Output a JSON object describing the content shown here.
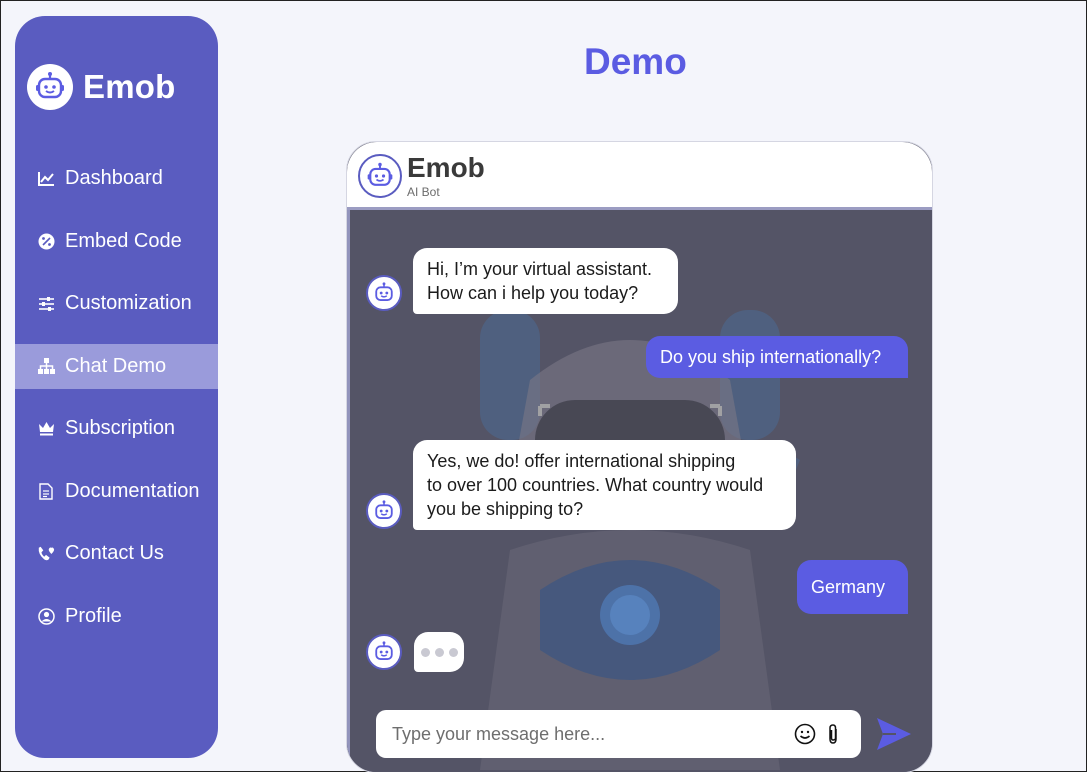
{
  "brand": {
    "name": "Emob"
  },
  "nav": {
    "items": [
      {
        "label": "Dashboard",
        "icon": "chart-line-icon"
      },
      {
        "label": "Embed Code",
        "icon": "code-badge-icon"
      },
      {
        "label": "Customization",
        "icon": "sliders-icon"
      },
      {
        "label": "Chat Demo",
        "icon": "sitemap-icon",
        "active": true
      },
      {
        "label": "Subscription",
        "icon": "crown-icon"
      },
      {
        "label": "Documentation",
        "icon": "document-icon"
      },
      {
        "label": "Contact Us",
        "icon": "phone-heart-icon"
      },
      {
        "label": "Profile",
        "icon": "user-circle-icon"
      }
    ]
  },
  "page": {
    "title": "Demo"
  },
  "chat": {
    "title": "Emob",
    "subtitle": "AI Bot",
    "messages": [
      {
        "from": "bot",
        "text": "Hi, I’m your virtual assistant.\nHow can i help you today?"
      },
      {
        "from": "user",
        "text": "Do you ship internationally?"
      },
      {
        "from": "bot",
        "text": "Yes, we do! offer international shipping\nto over 100 countries. What country would\nyou be shipping to?"
      },
      {
        "from": "user",
        "text": "Germany"
      }
    ],
    "input": {
      "placeholder": "Type your message here...",
      "value": ""
    }
  },
  "colors": {
    "sidebar": "#5a5cc0",
    "sidebar_active": "#9a9bdb",
    "accent": "#5b5ce2",
    "chat_bg": "#545466"
  }
}
